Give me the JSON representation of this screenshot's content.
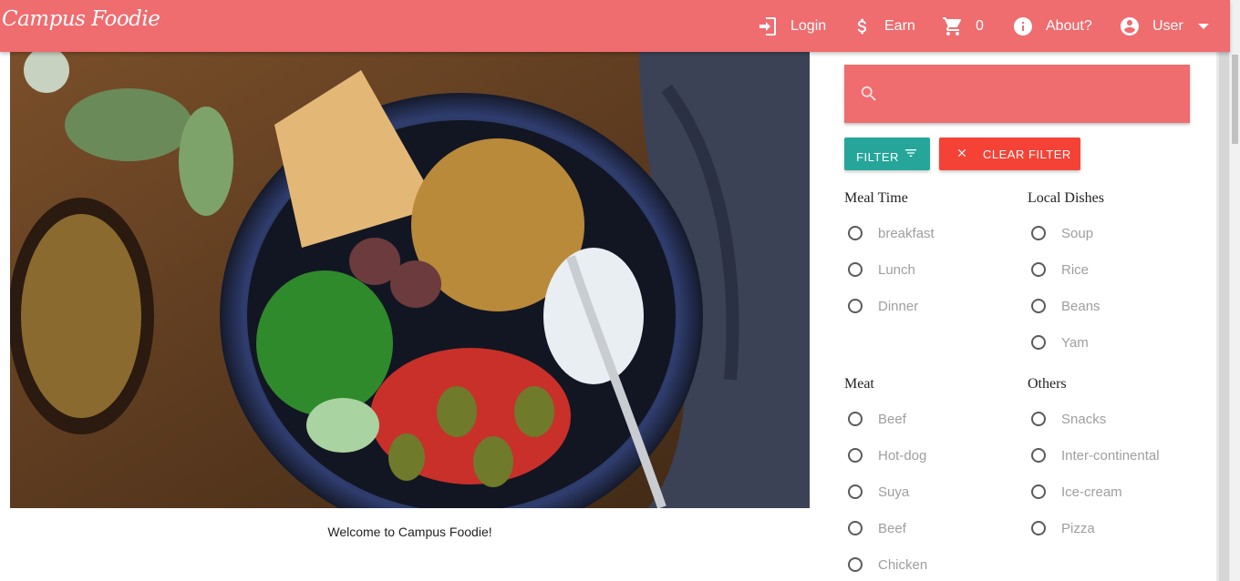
{
  "header": {
    "brand": "Campus Foodie",
    "nav": {
      "login": "Login",
      "earn": "Earn",
      "cart_count": "0",
      "about": "About?",
      "user": "User"
    },
    "icons": [
      "login-icon",
      "dollar-icon",
      "cart-icon",
      "info-icon",
      "account-circle-icon",
      "dropdown-arrow-icon"
    ],
    "color": "#ef6c6f"
  },
  "hero": {
    "caption": "Welcome to Campus Foodie!"
  },
  "search": {
    "placeholder": "",
    "value": ""
  },
  "filters": {
    "filter_label": "FILTER",
    "clear_label": "CLEAR FILTER",
    "filter_color": "#26a69a",
    "clear_color": "#f44336",
    "groups": [
      {
        "title": "Meal Time",
        "options": [
          "breakfast",
          "Lunch",
          "Dinner"
        ]
      },
      {
        "title": "Local Dishes",
        "options": [
          "Soup",
          "Rice",
          "Beans",
          "Yam"
        ]
      },
      {
        "title": "Meat",
        "options": [
          "Beef",
          "Hot-dog",
          "Suya",
          "Beef",
          "Chicken"
        ]
      },
      {
        "title": "Others",
        "options": [
          "Snacks",
          "Inter-continental",
          "Ice-cream",
          "Pizza"
        ]
      }
    ]
  }
}
